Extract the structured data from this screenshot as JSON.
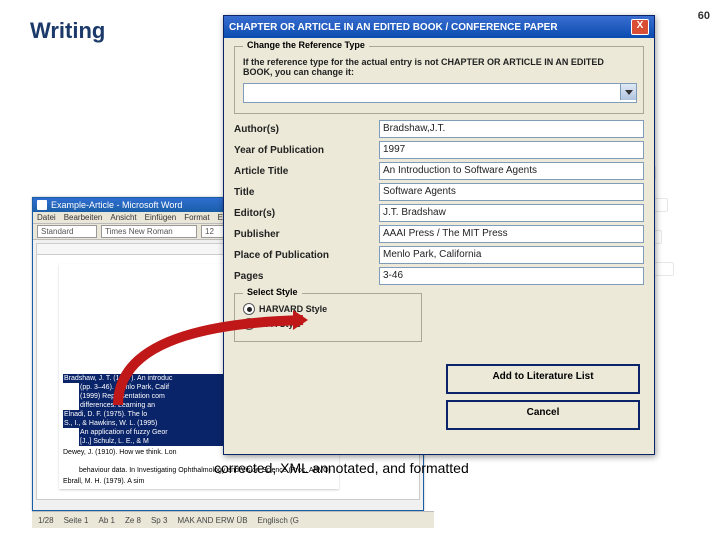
{
  "heading": "Writing",
  "page_number": "60",
  "caption": "corrected, XML annotated, and formatted",
  "word": {
    "title": "Example-Article - Microsoft Word",
    "menu": [
      "Datei",
      "Bearbeiten",
      "Ansicht",
      "Einfügen",
      "Format",
      "Extras",
      "?"
    ],
    "style_box": "Standard",
    "font_box": "Times New Roman",
    "size_box": "12",
    "selected_refs": [
      "Bradshaw, J. T. (1997). An introduc",
      "(pp. 3–46). Menlo Park, Calif",
      "(1999) Representation com",
      "differences. Learning an",
      "Elnadi, D. F. (1975). The lo",
      "S., I., & Hawkins, W. L. (1995)",
      "An application of fuzzy Geor",
      "[J.,] Schulz, L. E., & M"
    ],
    "plain_refs": [
      "Dewey, J. (1910). How we think. Lon",
      "behaviour data. In Investigating Ophthalmology and Vision Science (Proc. ARVO)",
      "Ebrall, M. H. (1979). A sim"
    ],
    "status": [
      "1/28",
      "Seite 1",
      "Ab 1",
      "Ze 8",
      "Sp 3",
      "MAK AND ERW ÜB",
      "Englisch (G"
    ]
  },
  "dialog": {
    "title": "CHAPTER OR ARTICLE IN AN EDITED BOOK / CONFERENCE PAPER",
    "close": "X",
    "change_group": {
      "title": "Change the Reference Type",
      "note": "If the reference type for the actual entry is not CHAPTER OR ARTICLE IN AN EDITED BOOK, you can change it:"
    },
    "fields": {
      "authors": {
        "label": "Author(s)",
        "value": "Bradshaw,J.T."
      },
      "year": {
        "label": "Year of Publication",
        "value": "1997"
      },
      "article_title": {
        "label": "Article Title",
        "value": "An Introduction to Software Agents"
      },
      "title": {
        "label": "Title",
        "value": "Software Agents"
      },
      "editors": {
        "label": "Editor(s)",
        "value": "J.T. Bradshaw"
      },
      "publisher": {
        "label": "Publisher",
        "value": "AAAI Press / The MIT Press"
      },
      "place": {
        "label": "Place of Publication",
        "value": "Menlo Park, California"
      },
      "pages": {
        "label": "Pages",
        "value": "3-46"
      }
    },
    "style_group": {
      "title": "Select Style",
      "harvard": "HARVARD Style",
      "apa": "APA Style"
    },
    "buttons": {
      "add": "Add to Literature List",
      "cancel": "Cancel"
    }
  }
}
